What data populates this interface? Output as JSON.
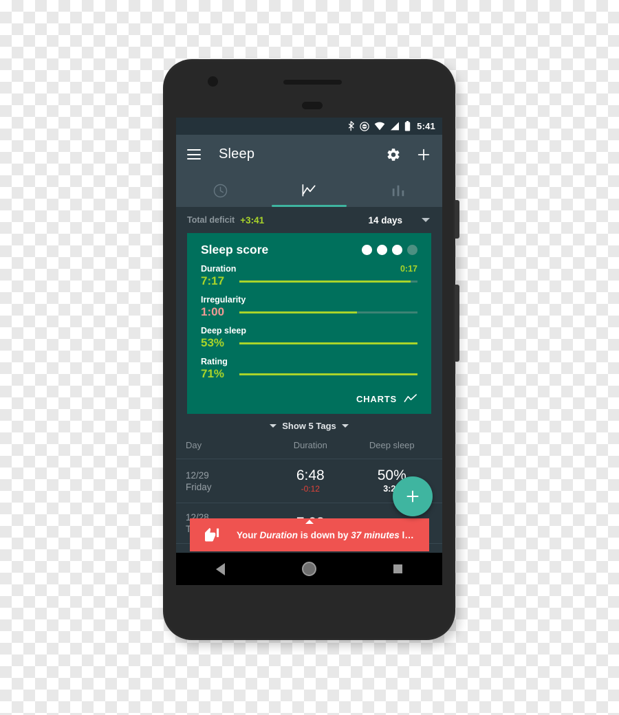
{
  "status_bar": {
    "icons": [
      "bluetooth-icon",
      "dnd-icon",
      "wifi-icon",
      "signal-icon",
      "battery-icon"
    ],
    "time": "5:41"
  },
  "app_bar": {
    "menu_icon": "hamburger-icon",
    "title": "Sleep",
    "settings_icon": "gear-icon",
    "add_icon": "plus-icon"
  },
  "tabs": [
    {
      "name": "clock-icon",
      "active": false
    },
    {
      "name": "line-chart-icon",
      "active": true
    },
    {
      "name": "bar-chart-icon",
      "active": false
    }
  ],
  "deficit": {
    "label": "Total deficit",
    "value": "+3:41",
    "value_color": "#a9d42a",
    "range": "14 days",
    "range_caret": "chevron-down-icon"
  },
  "score_card": {
    "title": "Sleep score",
    "accent_color": "#00705c",
    "bar_color": "#a9d42a",
    "dots_total": 4,
    "dots_filled": 3,
    "metrics": [
      {
        "name": "Duration",
        "value": "7:17",
        "value_color": "#a9d42a",
        "extra": "0:17",
        "fill_pct": 96
      },
      {
        "name": "Irregularity",
        "value": "1:00",
        "value_color": "#f09a94",
        "extra": "",
        "fill_pct": 66
      },
      {
        "name": "Deep sleep",
        "value": "53%",
        "value_color": "#a9d42a",
        "extra": "",
        "fill_pct": 100
      },
      {
        "name": "Rating",
        "value": "71%",
        "value_color": "#a9d42a",
        "extra": "",
        "fill_pct": 100
      }
    ],
    "charts_label": "CHARTS",
    "charts_icon": "line-chart-icon"
  },
  "tags_row": {
    "label": "Show 5 Tags",
    "left_caret": "chevron-down-icon",
    "right_caret": "chevron-down-icon"
  },
  "table": {
    "columns": [
      "Day",
      "Duration",
      "Deep sleep"
    ],
    "rows": [
      {
        "date": "12/29",
        "weekday": "Friday",
        "duration": "6:48",
        "duration_delta": "-0:12",
        "deep_pct": "50%",
        "deep_time": "3:24"
      },
      {
        "date": "12/28",
        "weekday": "Thursday",
        "duration": "7:08",
        "duration_delta": "",
        "deep_pct": "",
        "deep_time": ""
      }
    ]
  },
  "fab": {
    "icon": "plus-icon",
    "color": "#3fb5a0"
  },
  "snackbar": {
    "icon": "thumbs-down-icon",
    "color": "#ef5350",
    "text_part1": "Your ",
    "text_em1": "Duration",
    "text_part2": " is down by ",
    "text_em2": "37 minutes",
    "text_part3": " l…"
  },
  "nav_bar": {
    "back": "back-triangle-icon",
    "home": "home-circle-icon",
    "recents": "recents-square-icon"
  }
}
